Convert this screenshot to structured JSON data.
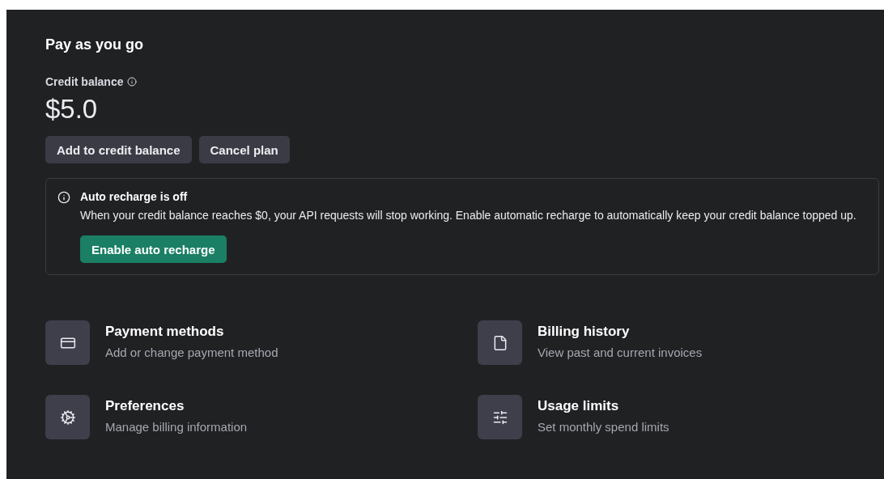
{
  "title": "Pay as you go",
  "balance": {
    "label": "Credit balance",
    "amount": "$5.0"
  },
  "buttons": [
    "Add to credit balance",
    "Cancel plan"
  ],
  "alert": {
    "title": "Auto recharge is off",
    "message": "When your credit balance reaches $0, your API requests will stop working. Enable automatic recharge to automatically keep your credit balance topped up.",
    "button": "Enable auto recharge"
  },
  "links": [
    {
      "title": "Payment methods",
      "description": "Add or change payment method"
    },
    {
      "title": "Billing history",
      "description": "View past and current invoices"
    },
    {
      "title": "Preferences",
      "description": "Manage billing information"
    },
    {
      "title": "Usage limits",
      "description": "Set monthly spend limits"
    }
  ]
}
